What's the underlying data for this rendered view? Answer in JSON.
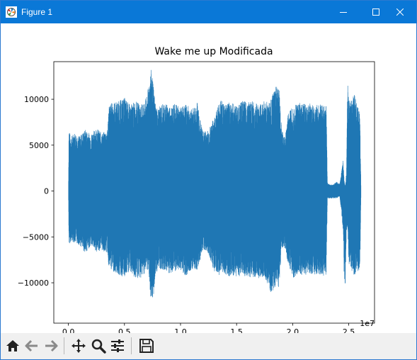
{
  "window": {
    "title": "Figure 1"
  },
  "toolbar": {
    "buttons": [
      {
        "name": "home",
        "icon": "home-icon"
      },
      {
        "name": "back",
        "icon": "arrow-left-icon"
      },
      {
        "name": "forward",
        "icon": "arrow-right-icon"
      },
      {
        "name": "pan",
        "icon": "move-icon"
      },
      {
        "name": "zoom",
        "icon": "magnifier-icon"
      },
      {
        "name": "configure",
        "icon": "sliders-icon"
      },
      {
        "name": "save",
        "icon": "floppy-icon"
      }
    ]
  },
  "colors": {
    "line": "#1f77b4",
    "titlebar": "#0a78d7"
  },
  "chart_data": {
    "type": "line",
    "title": "Wake me up Modificada",
    "xlabel": "",
    "ylabel": "",
    "x_offset_label": "1e7",
    "xlim": [
      -1300000,
      27300000
    ],
    "ylim": [
      -14400,
      14100
    ],
    "xticks": [
      0,
      5000000,
      10000000,
      15000000,
      20000000,
      25000000
    ],
    "xtick_labels": [
      "0.0",
      "0.5",
      "1.0",
      "1.5",
      "2.0",
      "2.5"
    ],
    "yticks": [
      -10000,
      -5000,
      0,
      5000,
      10000
    ],
    "ytick_labels": [
      "−10000",
      "−5000",
      "0",
      "5000",
      "10000"
    ],
    "grid": false,
    "envelope": {
      "x": [
        0,
        50000,
        200000,
        500000,
        1000000,
        1500000,
        2000000,
        2500000,
        3000000,
        3500000,
        3600000,
        3800000,
        4500000,
        5000000,
        5500000,
        6000000,
        6500000,
        7000000,
        7200000,
        7400000,
        7600000,
        7800000,
        8000000,
        8500000,
        9000000,
        9500000,
        10000000,
        10500000,
        11000000,
        11500000,
        11800000,
        12000000,
        12500000,
        13000000,
        13500000,
        14000000,
        14500000,
        15000000,
        15500000,
        16000000,
        16500000,
        17000000,
        17500000,
        18000000,
        18500000,
        18800000,
        19000000,
        19300000,
        19600000,
        19900000,
        20100000,
        20500000,
        21000000,
        21500000,
        22000000,
        22500000,
        23000000,
        23100000,
        23300000,
        23600000,
        23900000,
        24200000,
        24400000,
        24500000,
        24600000,
        24700000,
        24800000,
        24900000,
        25000000,
        25500000,
        26000000,
        26100000
      ],
      "max": [
        0,
        6900,
        5800,
        6400,
        6000,
        6700,
        6200,
        6900,
        6300,
        6700,
        9400,
        9600,
        9800,
        10200,
        9400,
        9800,
        9400,
        10300,
        12000,
        13400,
        11200,
        9300,
        9000,
        9700,
        9300,
        9500,
        9100,
        9500,
        8900,
        9700,
        7500,
        6500,
        6700,
        8000,
        10000,
        9600,
        9700,
        9300,
        9800,
        9800,
        9800,
        9300,
        9900,
        9800,
        11500,
        11100,
        7000,
        5700,
        8500,
        9300,
        9300,
        9800,
        9500,
        9600,
        9300,
        9500,
        9300,
        1000,
        700,
        700,
        1000,
        800,
        2500,
        3400,
        1100,
        500,
        2100,
        11900,
        10000,
        10500,
        8500,
        0
      ],
      "min": [
        0,
        -5900,
        -5500,
        -5600,
        -5900,
        -6800,
        -6000,
        -6600,
        -6500,
        -6800,
        -8400,
        -8600,
        -9200,
        -9500,
        -8800,
        -9600,
        -9500,
        -8600,
        -9200,
        -13200,
        -11300,
        -9000,
        -8600,
        -8600,
        -9000,
        -8900,
        -8600,
        -9300,
        -8500,
        -8600,
        -7300,
        -6300,
        -6900,
        -8800,
        -9200,
        -9100,
        -9400,
        -9300,
        -9300,
        -9500,
        -9400,
        -9500,
        -9300,
        -11300,
        -10400,
        -10500,
        -6200,
        -6200,
        -8000,
        -9000,
        -9500,
        -9100,
        -9200,
        -9000,
        -9100,
        -9400,
        -9100,
        -800,
        -800,
        -800,
        -800,
        -600,
        -2900,
        -4600,
        -10000,
        -10400,
        -4400,
        -4000,
        -8100,
        -9200,
        -8500,
        0
      ]
    }
  }
}
